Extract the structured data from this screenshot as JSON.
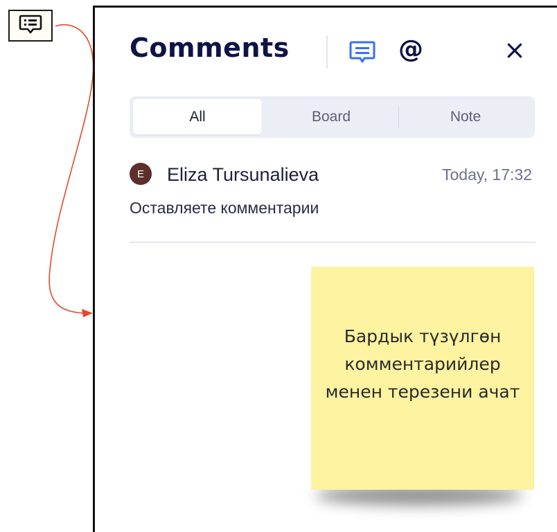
{
  "comments_panel": {
    "title": "Comments",
    "at_symbol": "@",
    "close_symbol": "×",
    "tabs": [
      {
        "label": "All",
        "active": true
      },
      {
        "label": "Board",
        "active": false
      },
      {
        "label": "Note",
        "active": false
      }
    ],
    "comment": {
      "avatar_initial": "E",
      "author": "Eliza Tursunalieva",
      "time": "Today, 17:32",
      "text": "Оставляете комментарии"
    }
  },
  "sticky_note": {
    "text": "Бардык түзүлгөн комментарийлер менен терезени ачат"
  },
  "colors": {
    "accent": "#3b6ef5",
    "title": "#0f1446",
    "arrow": "#e24a2b",
    "sticky": "#fdf3a0",
    "avatar": "#5d2f2a"
  },
  "icons": [
    "comment-icon",
    "at-icon",
    "close-icon"
  ]
}
